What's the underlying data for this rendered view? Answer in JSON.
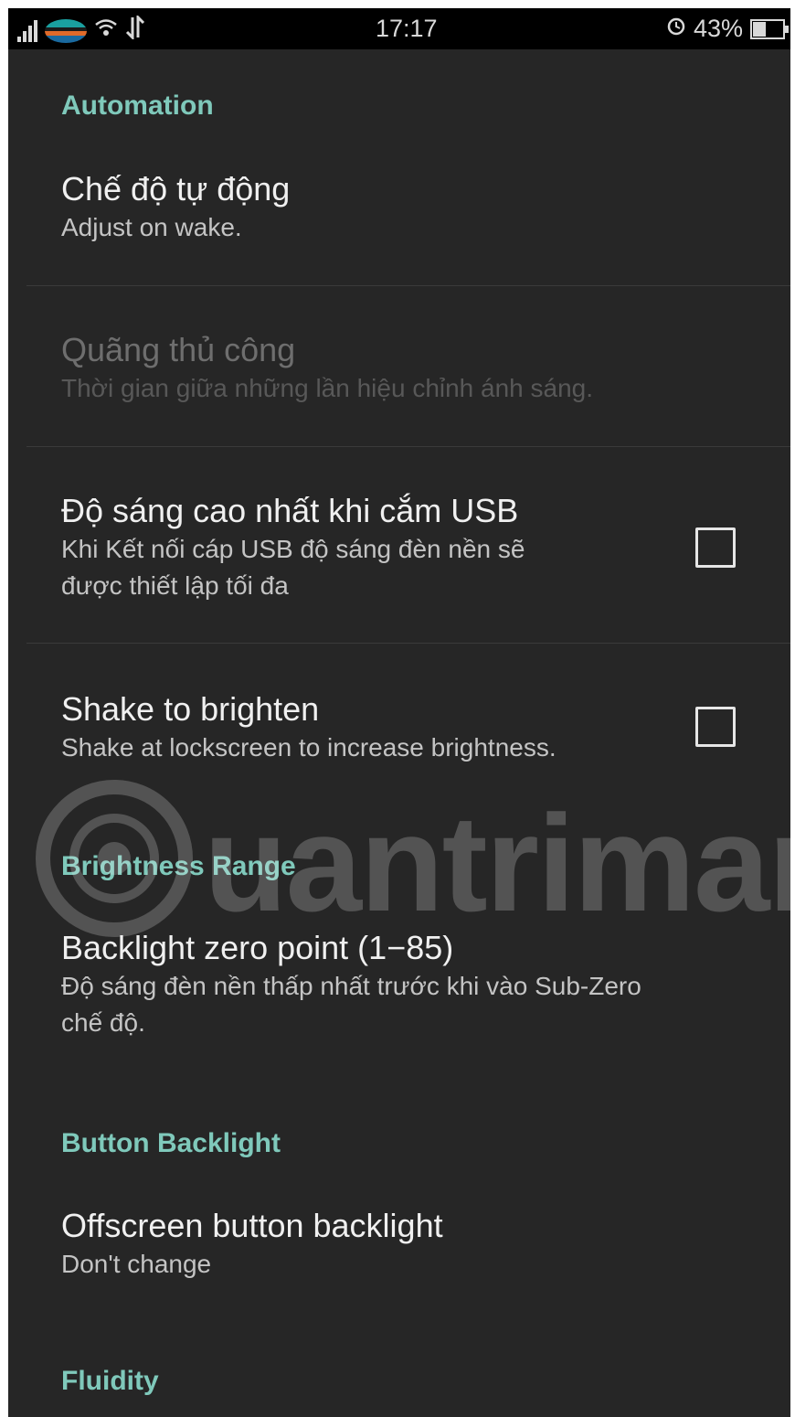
{
  "status_bar": {
    "time": "17:17",
    "battery_text": "43%",
    "battery_level": 0.43,
    "icons": [
      "signal-icon",
      "carrier-icon",
      "wifi-icon",
      "data-icon",
      "alarm-icon",
      "battery-icon"
    ]
  },
  "colors": {
    "background": "#262626",
    "accent": "#7fc9bb",
    "status_bar": "#000000"
  },
  "sections": {
    "automation": {
      "header": "Automation",
      "auto_mode": {
        "title": "Chế độ tự động",
        "summary": "Adjust on wake."
      },
      "manual_interval": {
        "title": "Quãng thủ công",
        "summary": "Thời gian giữa những lần hiệu chỉnh ánh sáng."
      },
      "usb_max": {
        "title": "Độ sáng cao nhất khi cắm USB",
        "summary_line1": "Khi Kết nối cáp USB độ sáng đèn nền sẽ",
        "summary_line2": "được thiết lập tối đa",
        "checked": false
      },
      "shake": {
        "title": "Shake to brighten",
        "summary": "Shake at lockscreen to increase brightness.",
        "checked": false
      }
    },
    "brightness_range": {
      "header": "Brightness Range",
      "zero_point": {
        "title": "Backlight zero point (1−85)",
        "summary_line1": "Độ sáng đèn nền thấp nhất trước khi vào Sub-Zero",
        "summary_line2": "chế độ."
      }
    },
    "button_backlight": {
      "header": "Button Backlight",
      "offscreen": {
        "title": "Offscreen button backlight",
        "summary": "Don't change"
      }
    },
    "fluidity": {
      "header": "Fluidity"
    }
  },
  "watermark": "uantrimang"
}
